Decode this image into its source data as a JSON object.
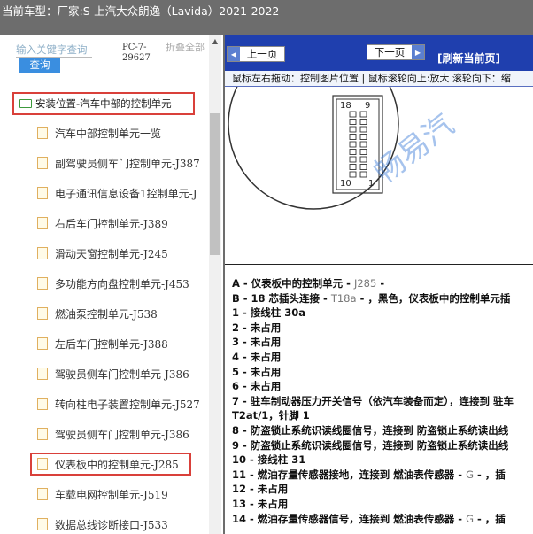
{
  "title": "当前车型：厂家:S-上汽大众朗逸（Lavida）2021-2022",
  "search": {
    "placeholder": "输入关键字查询",
    "button": "查询"
  },
  "pc_label": "PC-7-29627",
  "fold_label": "折叠全部",
  "tree": {
    "root": "安装位置-汽车中部的控制单元",
    "items": [
      "汽车中部控制单元一览",
      "副驾驶员侧车门控制单元-J387",
      "电子通讯信息设备1控制单元-J",
      "右后车门控制单元-J389",
      "滑动天窗控制单元-J245",
      "多功能方向盘控制单元-J453",
      "燃油泵控制单元-J538",
      "左后车门控制单元-J388",
      "驾驶员侧车门控制单元-J386",
      "转向柱电子装置控制单元-J527",
      "驾驶员侧车门控制单元-J386",
      "仪表板中的控制单元-J285",
      "车载电网控制单元-J519",
      "数据总线诊断接口-J533"
    ]
  },
  "toolbar": {
    "prev": "上一页",
    "next": "下一页",
    "refresh": "[刷新当前页]"
  },
  "hint": "鼠标左右拖动：控制图片位置 | 鼠标滚轮向上:放大  滚轮向下：缩",
  "diagram": {
    "pin_top_left": "18",
    "pin_top_right": "9",
    "pin_bottom_left": "10",
    "pin_bottom_right": "1",
    "watermark": "畅易汽"
  },
  "pins": [
    {
      "a": "A - 仪表板中的控制单元 - ",
      "b": "J285",
      "c": " -"
    },
    {
      "a": "B - 18 芯插头连接 - ",
      "b": "T18a",
      "c": " - ，黑色，仪表板中的控制单元插"
    },
    {
      "a": "1 - 接线柱 30a",
      "b": "",
      "c": ""
    },
    {
      "a": "2 - 未占用",
      "b": "",
      "c": ""
    },
    {
      "a": "3 - 未占用",
      "b": "",
      "c": ""
    },
    {
      "a": "4 - 未占用",
      "b": "",
      "c": ""
    },
    {
      "a": "5 - 未占用",
      "b": "",
      "c": ""
    },
    {
      "a": "6 - 未占用",
      "b": "",
      "c": ""
    },
    {
      "a": "7 - 驻车制动器压力开关信号（依汽车装备而定），连接到 驻车",
      "b": "",
      "c": ""
    },
    {
      "a": "     T2at/1，针脚 1",
      "b": "",
      "c": ""
    },
    {
      "a": "8 - 防盗锁止系统识读线圈信号，连接到 防盗锁止系统读出线",
      "b": "",
      "c": ""
    },
    {
      "a": "9 - 防盗锁止系统识读线圈信号，连接到 防盗锁止系统读出线",
      "b": "",
      "c": ""
    },
    {
      "a": "10 - 接线柱 31",
      "b": "",
      "c": ""
    },
    {
      "a": "11 - 燃油存量传感器接地，连接到 燃油表传感器 - ",
      "b": "G",
      "c": " - ，插"
    },
    {
      "a": "12 - 未占用",
      "b": "",
      "c": ""
    },
    {
      "a": "13 - 未占用",
      "b": "",
      "c": ""
    },
    {
      "a": "14 - 燃油存量传感器信号，连接到 燃油表传感器 - ",
      "b": "G",
      "c": " - ，插"
    }
  ]
}
